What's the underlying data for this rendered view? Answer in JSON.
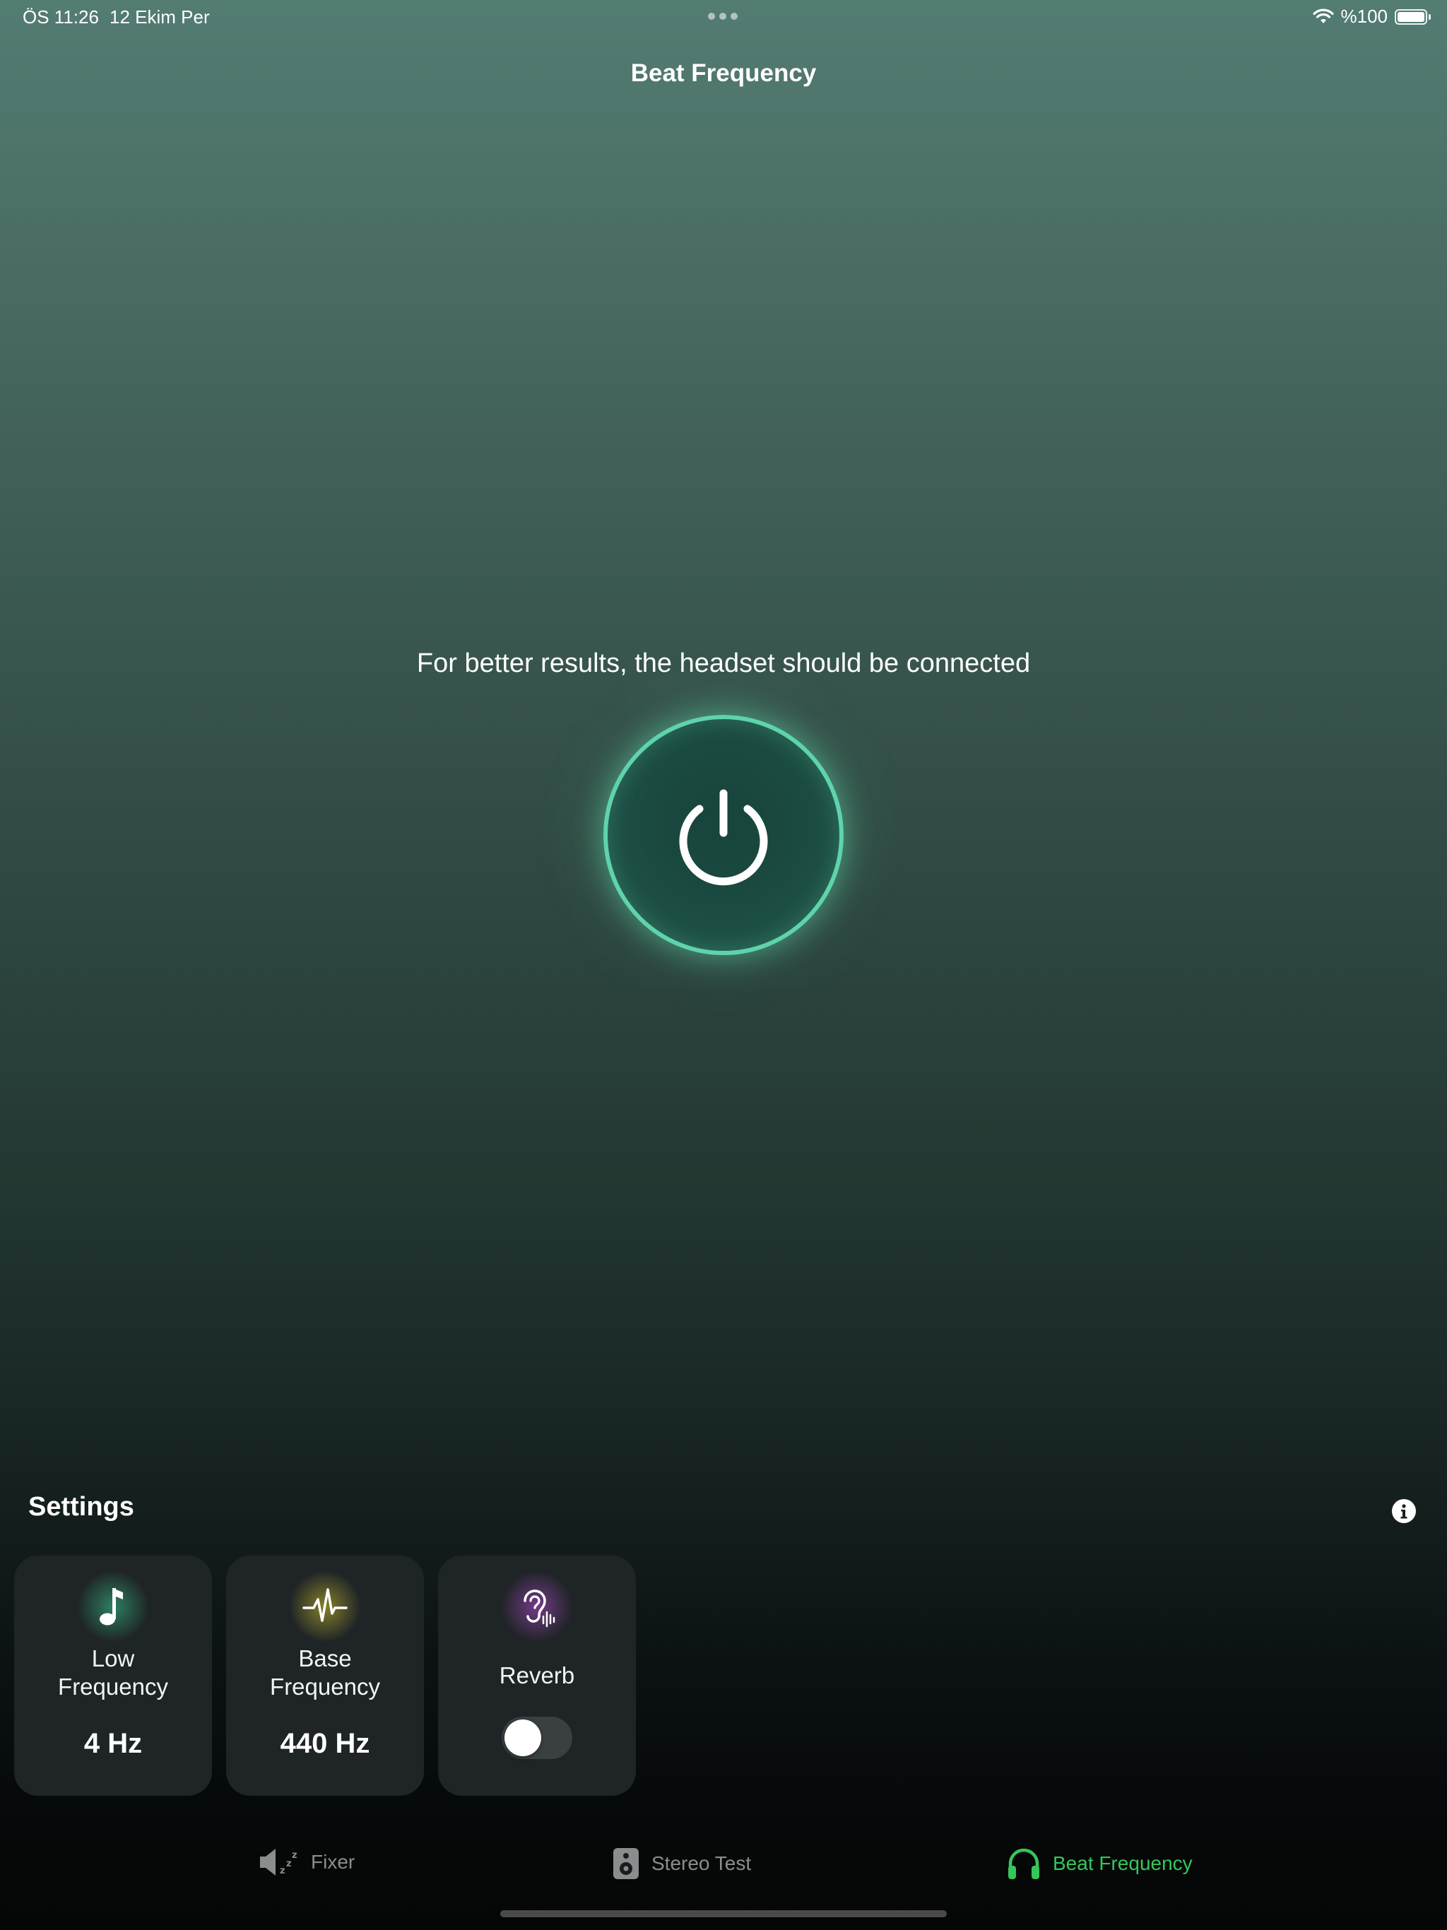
{
  "status_bar": {
    "time": "ÖS 11:26",
    "date": "12 Ekim Per",
    "battery": "%100"
  },
  "nav": {
    "title": "Beat Frequency"
  },
  "main": {
    "hint": "For better results, the headset should be connected",
    "power_icon": "power-icon",
    "accent_color": "#5fd3ac"
  },
  "settings": {
    "title": "Settings",
    "info_icon": "info-icon",
    "cards": [
      {
        "icon": "music-note-icon",
        "label_line1": "Low",
        "label_line2": "Frequency",
        "value": "4 Hz",
        "glow": "#2e8a67"
      },
      {
        "icon": "waveform-icon",
        "label_line1": "Base",
        "label_line2": "Frequency",
        "value": "440 Hz",
        "glow": "#8f8a2c"
      },
      {
        "icon": "ear-icon",
        "label": "Reverb",
        "toggle_on": false,
        "glow": "#7b3e92"
      }
    ]
  },
  "tabs": [
    {
      "label": "Fixer",
      "icon": "speaker-sleep-icon",
      "active": false
    },
    {
      "label": "Stereo Test",
      "icon": "stereo-speaker-icon",
      "active": false
    },
    {
      "label": "Beat Frequency",
      "icon": "headphones-icon",
      "active": true
    }
  ],
  "colors": {
    "tab_active": "#34c759",
    "tab_inactive": "#8a8d8e"
  }
}
